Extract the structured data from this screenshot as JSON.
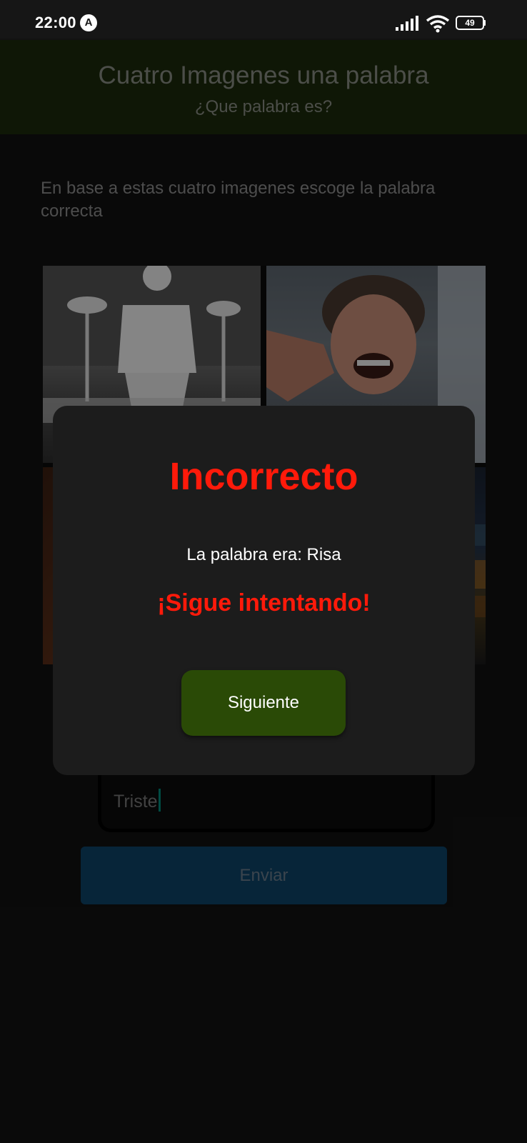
{
  "status_bar": {
    "time": "22:00",
    "badge": "A",
    "battery": "49"
  },
  "header": {
    "title": "Cuatro Imagenes una palabra",
    "subtitle": "¿Que palabra es?"
  },
  "instructions": "En base a estas cuatro imagenes escoge la palabra correcta",
  "images": [
    {
      "name": "image-man-laughing"
    },
    {
      "name": "image-woman-laughing"
    },
    {
      "name": "image-3"
    },
    {
      "name": "image-4"
    }
  ],
  "answer": {
    "value": "Triste"
  },
  "submit_label": "Enviar",
  "modal": {
    "title": "Incorrecto",
    "word_text": "La palabra era: Risa",
    "encourage": "¡Sigue intentando!",
    "next_label": "Siguiente"
  },
  "colors": {
    "header_bg": "#1d2b0b",
    "error_red": "#ff1a0a",
    "next_button": "#2a4a06",
    "submit_button": "#0e4469",
    "caret": "#00897b"
  }
}
